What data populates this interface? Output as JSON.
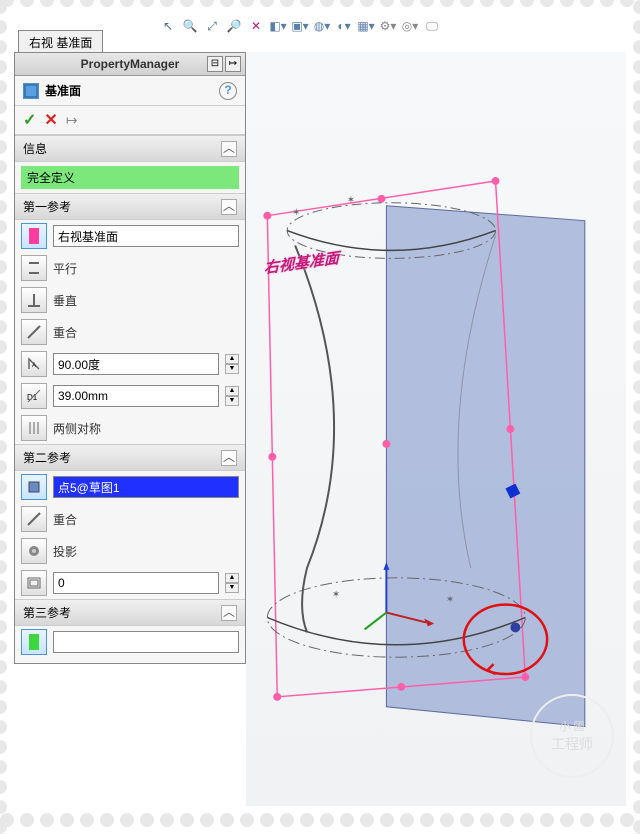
{
  "tab": {
    "label": "右视 基准面"
  },
  "toolbar_icons": [
    "arrow",
    "zoom-prev",
    "zoom-fit",
    "zoom-area",
    "section",
    "view-orient",
    "display-style",
    "hide-show",
    "edit-appear",
    "scene",
    "view-setting",
    "render",
    "screen"
  ],
  "pm": {
    "title": "PropertyManager",
    "feature_name": "基准面",
    "actions": {
      "ok": "✓",
      "cancel": "✕",
      "pin": "↦"
    },
    "info": {
      "header": "信息",
      "status": "完全定义"
    },
    "ref1": {
      "header": "第一参考",
      "selection": "右视基准面",
      "opt_parallel": "平行",
      "opt_perp": "垂直",
      "opt_coincident": "重合",
      "angle": "90.00度",
      "distance": "39.00mm",
      "opt_symmetric": "两侧对称"
    },
    "ref2": {
      "header": "第二参考",
      "selection": "点5@草图1",
      "opt_coincident": "重合",
      "opt_project": "投影",
      "value": "0"
    },
    "ref3": {
      "header": "第三参考",
      "selection": ""
    }
  },
  "viewport": {
    "plane_label": "右视基准面",
    "watermark_top": "小 國",
    "watermark_bottom": "工程师"
  }
}
